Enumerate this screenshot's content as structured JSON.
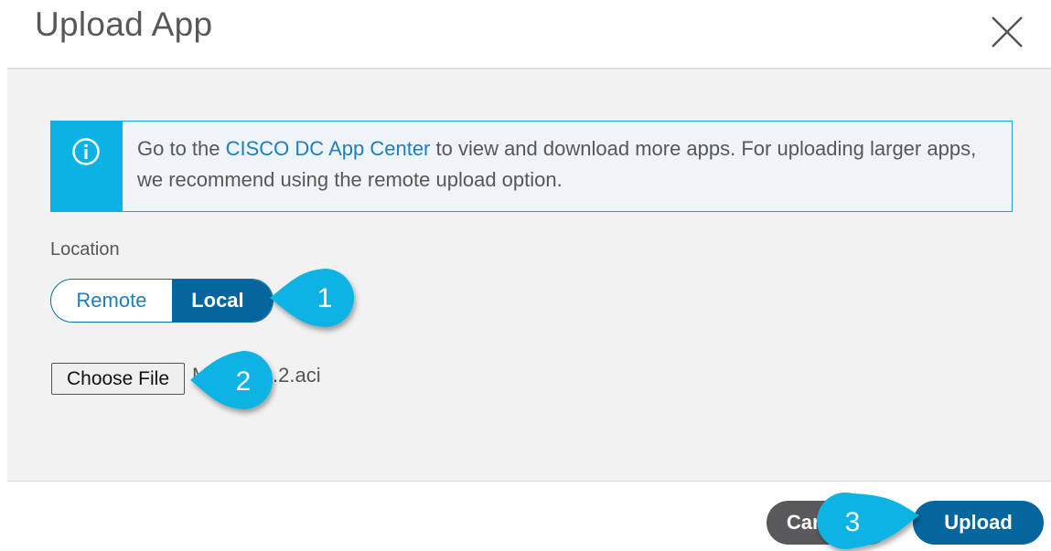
{
  "dialog": {
    "title": "Upload App",
    "close_icon": "close-icon"
  },
  "alert": {
    "icon": "info-icon",
    "text_before": "Go to the ",
    "link_text": "CISCO DC App Center",
    "text_after": " to view and download more apps. For uploading larger apps, we recommend using the remote upload option.",
    "accent_color": "#0ab3e3"
  },
  "location": {
    "label": "Location",
    "options": [
      "Remote",
      "Local"
    ],
    "selected": "Local"
  },
  "file": {
    "button_label": "Choose File",
    "filename": "MSO-3.0.2.aci"
  },
  "footer": {
    "cancel_label": "Cancel",
    "upload_label": "Upload"
  },
  "callouts": [
    "1",
    "2",
    "3"
  ],
  "colors": {
    "primary": "#04669c",
    "callout": "#0ab3e3",
    "cancel": "#59595b"
  }
}
